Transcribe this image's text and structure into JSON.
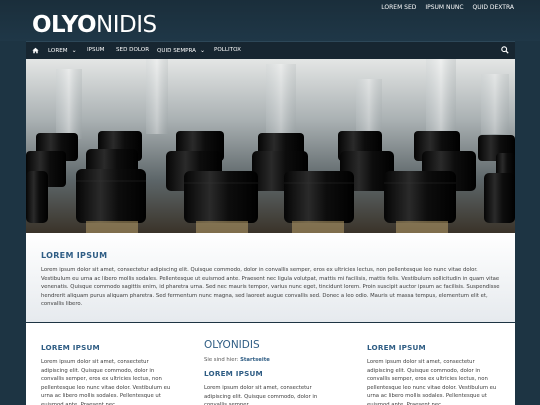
{
  "logo": {
    "bold": "OLYO",
    "light": "NIDIS"
  },
  "topnav": [
    "LOREM SED",
    "IPSUM NUNC",
    "QUID DEXTRA"
  ],
  "nav": {
    "items": [
      {
        "label": "LOREM",
        "dropdown": true
      },
      {
        "label": "IPSUM",
        "dropdown": false
      },
      {
        "label": "SED DOLOR",
        "dropdown": false
      },
      {
        "label": "QUID SEMPRA",
        "dropdown": true
      },
      {
        "label": "POLLITOX",
        "dropdown": false
      }
    ]
  },
  "intro": {
    "heading": "LOREM IPSUM",
    "text": "Lorem ipsum dolor sit amet, consectetur adipiscing elit. Quisque commodo, dolor in convallis semper, eros ex ultricies lectus, non pellentesque leo nunc vitae dolor. Vestibulum eu urna ac libero mollis sodales. Pellentesque ut euismod ante. Praesent nec ligula volutpat, mattis mi facilisis, mattis felis. Vestibulum sollicitudin in quam vitae venenatis. Quisque commodo sagittis enim, id pharetra urna. Sed nec mauris tempor, varius nunc eget, tincidunt lorem. Proin suscipit auctor ipsum ac facilisis. Suspendisse hendrerit aliquam purus aliquam pharetra. Sed fermentum nunc magna, sed laoreet augue convallis sed. Donec a leo odio. Mauris ut massa tempus, elementum elit et, convallis libero."
  },
  "columns": {
    "left": {
      "heading": "LOREM IPSUM",
      "text": "Lorem ipsum dolor sit amet, consectetur adipiscing elit. Quisque commodo, dolor in convallis semper, eros ex ultricies lectus, non pellentesque leo nunc vitae dolor. Vestibulum eu urna ac libero mollis sodales. Pellentesque ut euismod ante. Praesent nec"
    },
    "middle": {
      "title": "OLYONIDIS",
      "breadcrumb_prefix": "Sie sind hier:",
      "breadcrumb_link": "Startseite",
      "heading": "LOREM IPSUM",
      "text": "Lorem ipsum dolor sit amet, consectetur adipiscing elit. Quisque commodo, dolor in convallis semper."
    },
    "right": {
      "heading": "LOREM IPSUM",
      "text": "Lorem ipsum dolor sit amet, consectetur adipiscing elit. Quisque commodo, dolor in convallis semper, eros ex ultricies lectus, non pellentesque leo nunc vitae dolor. Vestibulum eu urna ac libero mollis sodales. Pellentesque ut euismod ante. Praesent nec"
    }
  },
  "colors": {
    "accent": "#2f5d84",
    "header": "#1d3443",
    "navbar": "#172631"
  }
}
